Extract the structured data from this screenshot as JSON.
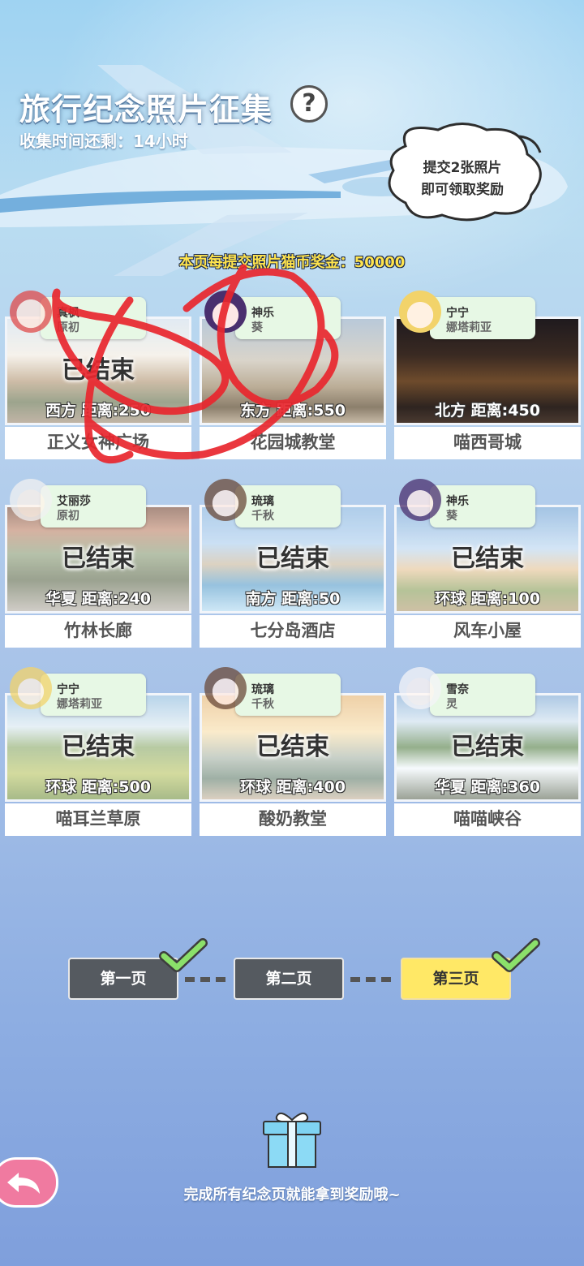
{
  "event": {
    "title": "旅行纪念照片征集",
    "help_symbol": "?",
    "time_left": "收集时间还剩：14小时",
    "bubble_line1": "提交2张照片",
    "bubble_line2": "即可领取奖励",
    "page_bonus": "本页每提交照片猫币奖金：50000"
  },
  "cards": [
    {
      "char_name": "真枫",
      "char_sub": "原初",
      "status": "已结束",
      "distance": "西方  距离:250",
      "place": "正义女神广场"
    },
    {
      "char_name": "神乐",
      "char_sub": "葵",
      "status": "",
      "distance": "东方  距离:550",
      "place": "花园城教堂"
    },
    {
      "char_name": "宁宁",
      "char_sub": "娜塔莉亚",
      "status": "",
      "distance": "北方  距离:450",
      "place": "喵西哥城"
    },
    {
      "char_name": "艾丽莎",
      "char_sub": "原初",
      "status": "已结束",
      "distance": "华夏  距离:240",
      "place": "竹林长廊"
    },
    {
      "char_name": "琉璃",
      "char_sub": "千秋",
      "status": "已结束",
      "distance": "南方  距离:50",
      "place": "七分岛酒店"
    },
    {
      "char_name": "神乐",
      "char_sub": "葵",
      "status": "已结束",
      "distance": "环球  距离:100",
      "place": "风车小屋"
    },
    {
      "char_name": "宁宁",
      "char_sub": "娜塔莉亚",
      "status": "已结束",
      "distance": "环球  距离:500",
      "place": "喵耳兰草原"
    },
    {
      "char_name": "琉璃",
      "char_sub": "千秋",
      "status": "已结束",
      "distance": "环球  距离:400",
      "place": "酸奶教堂"
    },
    {
      "char_name": "雪奈",
      "char_sub": "灵",
      "status": "已结束",
      "distance": "华夏  距离:360",
      "place": "喵喵峡谷"
    }
  ],
  "pages": [
    {
      "label": "第一页",
      "completed": true
    },
    {
      "label": "第二页",
      "completed": false
    },
    {
      "label": "第三页",
      "completed": true,
      "current": true
    }
  ],
  "footer": {
    "text": "完成所有纪念页就能拿到奖励哦~"
  },
  "colors": {
    "accent_yellow": "#ffe866",
    "tag_green": "#e7f8e5",
    "back_pink": "#f07aa0",
    "scribble_red": "#e8262e"
  }
}
